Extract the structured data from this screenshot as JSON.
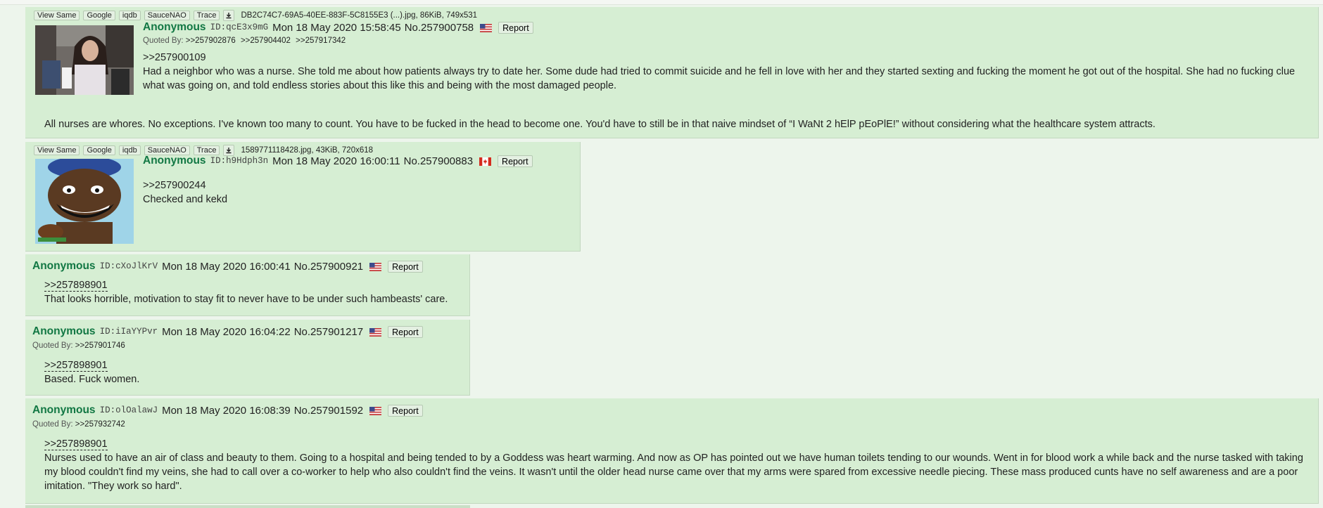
{
  "tools": {
    "view_same": "View Same",
    "google": "Google",
    "iqdb": "iqdb",
    "saucenao": "SauceNAO",
    "trace": "Trace"
  },
  "posts": [
    {
      "file": "DB2C74C7-69A5-40EE-883F-5C8155E3 (...).jpg, 86KiB, 749x531",
      "name": "Anonymous",
      "id": "ID:qcE3x9mG",
      "date": "Mon 18 May 2020 15:58:45",
      "no": "No.257900758",
      "flag": "us",
      "report": "Report",
      "quoted_by_label": "Quoted By:",
      "quoted_by": [
        ">>257902876",
        ">>257904402",
        ">>257917342"
      ],
      "quote": ">>257900109",
      "line1": "Had a neighbor who was a nurse. She told me about how patients always try to date her. Some dude had tried to commit suicide and he fell in love with her and they started sexting and fucking the moment he got out of the hospital. She had no fucking clue what was going on, and told endless stories about this like this and being with the most damaged people.",
      "line2": "All nurses are whores. No exceptions. I've known too many to count. You have to be fucked in the head to become one. You'd have to still be in that naive mindset of “I WaNt 2 hElP pEoPlE!” without considering what the healthcare system attracts."
    },
    {
      "file": "1589771118428.jpg, 43KiB, 720x618",
      "name": "Anonymous",
      "id": "ID:h9Hdph3n",
      "date": "Mon 18 May 2020 16:00:11",
      "no": "No.257900883",
      "flag": "ca",
      "report": "Report",
      "quote": ">>257900244",
      "line1": "Checked and kekd"
    },
    {
      "name": "Anonymous",
      "id": "ID:cXoJlKrV",
      "date": "Mon 18 May 2020 16:00:41",
      "no": "No.257900921",
      "flag": "us",
      "report": "Report",
      "quote": ">>257898901",
      "line1": "That looks horrible, motivation to stay fit to never have to be under such hambeasts' care."
    },
    {
      "name": "Anonymous",
      "id": "ID:iIaYYPvr",
      "date": "Mon 18 May 2020 16:04:22",
      "no": "No.257901217",
      "flag": "us",
      "report": "Report",
      "quoted_by_label": "Quoted By:",
      "quoted_by": [
        ">>257901746"
      ],
      "quote": ">>257898901",
      "line1": "Based. Fuck women."
    },
    {
      "name": "Anonymous",
      "id": "ID:olOalawJ",
      "date": "Mon 18 May 2020 16:08:39",
      "no": "No.257901592",
      "flag": "us",
      "report": "Report",
      "quoted_by_label": "Quoted By:",
      "quoted_by": [
        ">>257932742"
      ],
      "quote": ">>257898901",
      "line1": "Nurses used to have an air of class and beauty to them. Going to a hospital and being tended to by a Goddess was heart warming. And now as OP has pointed out we have human toilets tending to our wounds. Went in for blood work a while back and the nurse tasked with taking my blood couldn't find my veins, she had to call over a co-worker to help who also couldn't find the veins. It wasn't until the older head nurse came over that my arms were spared from excessive needle piecing. These mass produced cunts have no self awareness and are a poor imitation. \"They work so hard\"."
    }
  ],
  "colors": {
    "post_bg": "#d6eed3",
    "page_bg": "#edf5ec",
    "name": "#117743"
  }
}
